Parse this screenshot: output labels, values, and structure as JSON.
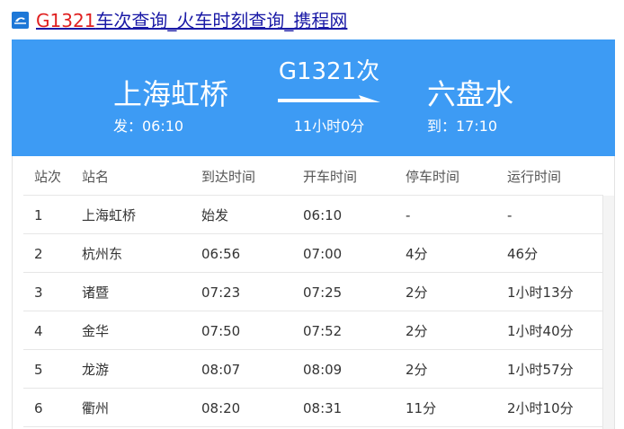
{
  "page": {
    "title_highlight": "G1321",
    "title_rest": "车次查询_火车时刻查询_携程网"
  },
  "hero": {
    "from_station": "上海虹桥",
    "departure_text": "发：06:10",
    "train_no": "G1321次",
    "duration_text": "11小时0分",
    "to_station": "六盘水",
    "arrival_text": "到：17:10"
  },
  "table": {
    "headers": [
      "站次",
      "站名",
      "到达时间",
      "开车时间",
      "停车时间",
      "运行时间"
    ],
    "rows": [
      [
        "1",
        "上海虹桥",
        "始发",
        "06:10",
        "-",
        "-"
      ],
      [
        "2",
        "杭州东",
        "06:56",
        "07:00",
        "4分",
        "46分"
      ],
      [
        "3",
        "诸暨",
        "07:23",
        "07:25",
        "2分",
        "1小时13分"
      ],
      [
        "4",
        "金华",
        "07:50",
        "07:52",
        "2分",
        "1小时40分"
      ],
      [
        "5",
        "龙游",
        "08:07",
        "08:09",
        "2分",
        "1小时57分"
      ],
      [
        "6",
        "衢州",
        "08:20",
        "08:31",
        "11分",
        "2小时10分"
      ]
    ]
  },
  "colors": {
    "hero_bg": "#3d9bf4",
    "title_link": "#1a1aa6",
    "title_highlight": "#e02020"
  },
  "icons": {
    "logo": "ctrip-logo-icon",
    "arrow": "route-arrow-icon"
  }
}
